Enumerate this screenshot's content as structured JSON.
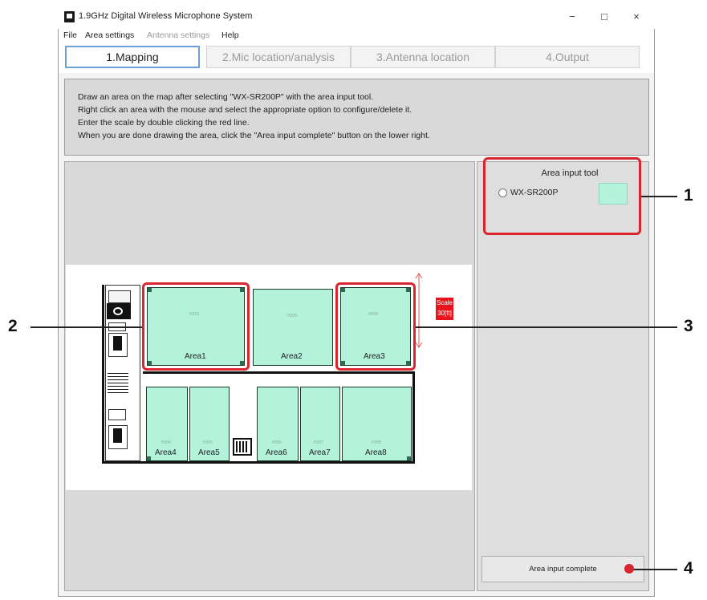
{
  "window": {
    "title": "1.9GHz Digital Wireless Microphone System",
    "controls": {
      "minimize": "−",
      "maximize": "□",
      "close": "×"
    }
  },
  "menu": [
    "File",
    "Area settings",
    "Antenna settings",
    "Help"
  ],
  "tabs": [
    "1.Mapping",
    "2.Mic location/analysis",
    "3.Antenna location",
    "4.Output"
  ],
  "instructions": [
    "Draw an area on the map after selecting \"WX-SR200P\" with the area input tool.",
    "Right click an area with the mouse and select the appropriate option to configure/delete it.",
    "Enter the scale by double clicking the red line.",
    "When you are done drawing the area, click the \"Area input complete\" button on the lower right."
  ],
  "area_tool": {
    "label": "Area input tool",
    "option": "WX-SR200P",
    "swatch_color": "#b3f3dc"
  },
  "scale": {
    "label": "Scale",
    "value": "30[ft]"
  },
  "areas": {
    "a1": {
      "label": "Area1",
      "code": "H210"
    },
    "a2": {
      "label": "Area2",
      "code": "H209"
    },
    "a3": {
      "label": "Area3",
      "code": "H208"
    },
    "a4": {
      "label": "Area4",
      "code": "H204"
    },
    "a5": {
      "label": "Area5",
      "code": "H205"
    },
    "a6": {
      "label": "Area6",
      "code": "H206"
    },
    "a7": {
      "label": "Area7",
      "code": "H207"
    },
    "a8": {
      "label": "Area8",
      "code": "H208"
    }
  },
  "complete_button": "Area input complete",
  "callouts": [
    "1",
    "2",
    "3",
    "4"
  ],
  "colors": {
    "highlight": "#d9262e",
    "area_fill": "#b3f3dc",
    "active_tab_border": "#6d9fd9"
  }
}
